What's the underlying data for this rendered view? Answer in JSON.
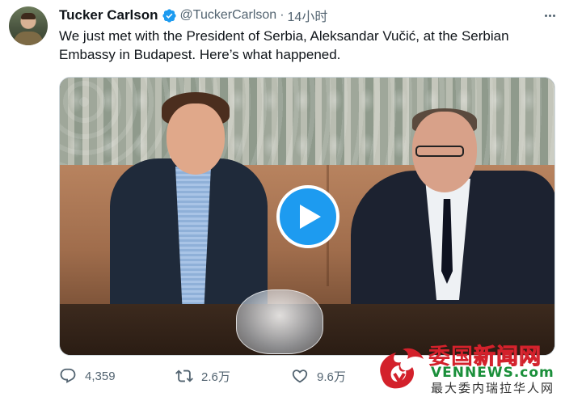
{
  "author": {
    "name": "Tucker Carlson",
    "handle": "@TuckerCarlson",
    "separator": "·",
    "time": "14小时",
    "verified": true
  },
  "tweet": {
    "text": "We just met with the President of Serbia, Aleksandar Vučić, at the Serbian Embassy in Budapest. Here’s what happened."
  },
  "media": {
    "type": "video"
  },
  "actions": {
    "replies": "4,359",
    "retweets": "2.6万",
    "likes": "9.6万"
  },
  "watermark": {
    "cn_red": "委国",
    "cn_outline": "新闻网",
    "en": "VENNEWS.com",
    "sub": "最大委内瑞拉华人网"
  },
  "colors": {
    "accent": "#1d9bf0",
    "text_primary": "#0f1419",
    "text_secondary": "#536471",
    "watermark_red": "#d3212b",
    "watermark_green": "#1a8f3a"
  },
  "icons": {
    "verified": "verified-badge-icon",
    "more": "more-icon",
    "play": "play-icon",
    "reply": "reply-icon",
    "retweet": "retweet-icon",
    "like": "heart-icon"
  }
}
